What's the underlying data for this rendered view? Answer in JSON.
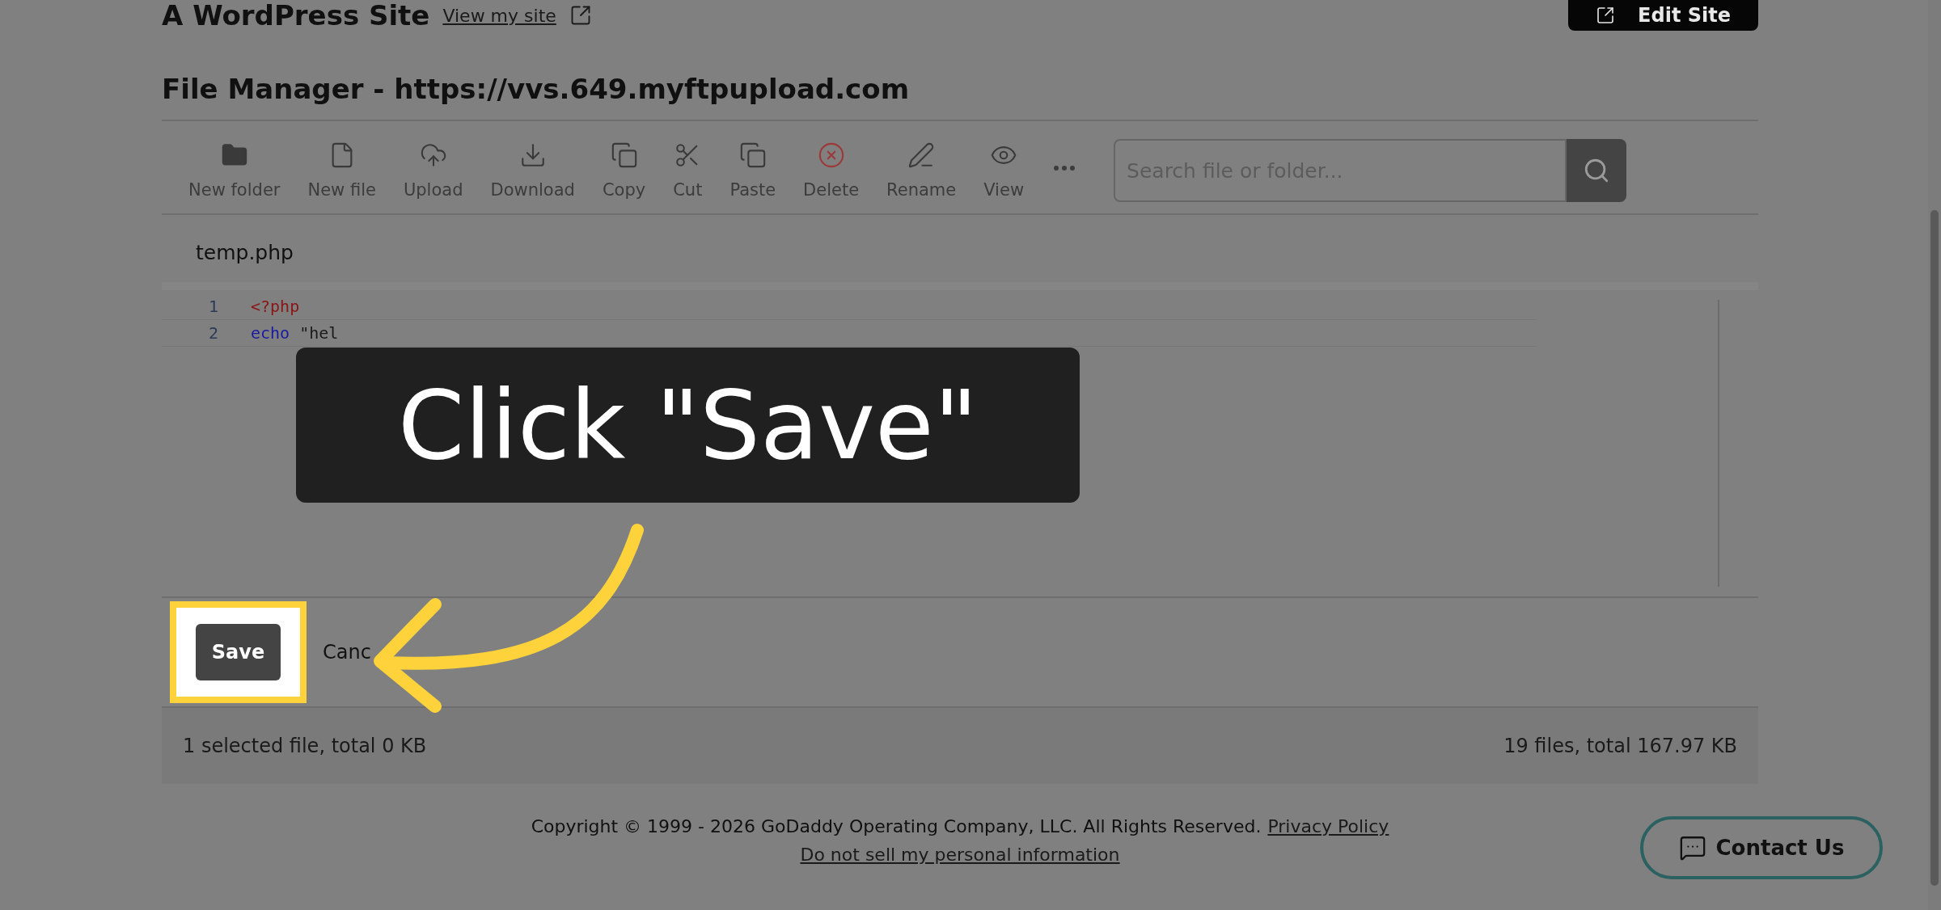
{
  "site": {
    "title": "A WordPress Site",
    "view_link": "View my site",
    "edit_button": "Edit Site"
  },
  "file_manager": {
    "title": "File Manager - https://vvs.649.myftpupload.com"
  },
  "toolbar": [
    {
      "label": "New folder",
      "kind": "folder"
    },
    {
      "label": "New file",
      "kind": "file"
    },
    {
      "label": "Upload",
      "kind": "upload"
    },
    {
      "label": "Download",
      "kind": "download"
    },
    {
      "label": "Copy",
      "kind": "copy"
    },
    {
      "label": "Cut",
      "kind": "cut"
    },
    {
      "label": "Paste",
      "kind": "paste"
    },
    {
      "label": "Delete",
      "kind": "delete"
    },
    {
      "label": "Rename",
      "kind": "rename"
    },
    {
      "label": "View",
      "kind": "view"
    },
    {
      "kind": "more"
    }
  ],
  "search": {
    "placeholder": "Search file or folder..."
  },
  "editor": {
    "file_name": "temp.php",
    "lines": [
      {
        "number": "1",
        "tokens": [
          {
            "text": "<?php",
            "kind": "tag"
          }
        ]
      },
      {
        "number": "2",
        "tokens": [
          {
            "text": "echo",
            "kind": "keyword"
          },
          {
            "text": "\"hel",
            "kind": "string"
          }
        ]
      }
    ]
  },
  "actions": {
    "save": "Save",
    "cancel": "Canc"
  },
  "status_bar": {
    "left": "1 selected file, total 0 KB",
    "right": "19 files, total 167.97 KB"
  },
  "footer": {
    "copyright": "Copyright © 1999 - 2026 GoDaddy Operating Company, LLC. All Rights Reserved.",
    "privacy_link": "Privacy Policy",
    "do_not_sell_link": "Do not sell my personal information"
  },
  "contact_button": "Contact Us",
  "callout": {
    "text": "Click \"Save\""
  }
}
